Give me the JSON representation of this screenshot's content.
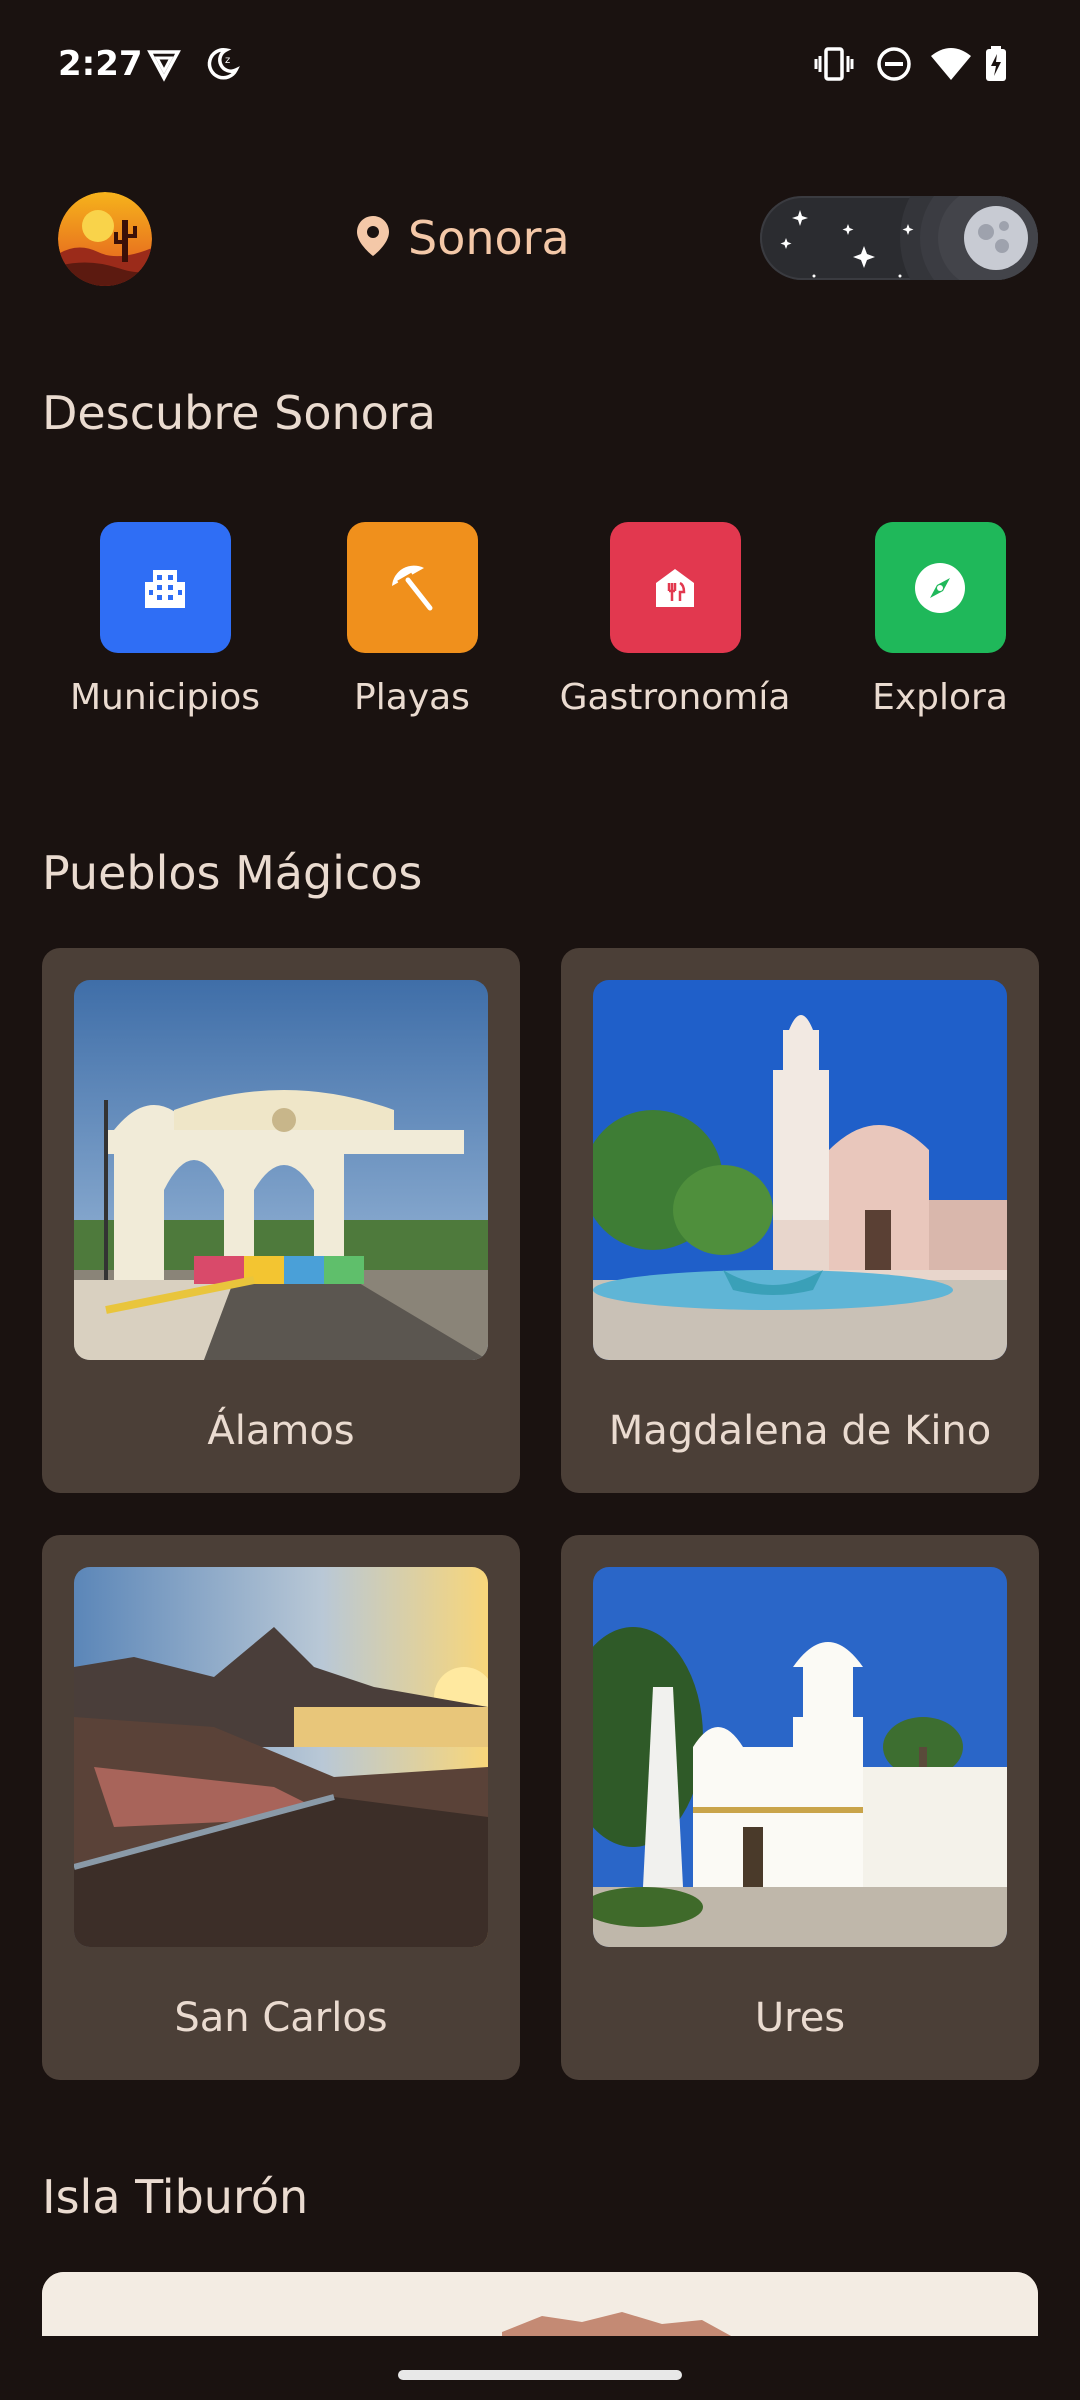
{
  "status_bar": {
    "time": "2:27",
    "left_icons": [
      "vpn-shield-icon",
      "moon-icon"
    ],
    "right_icons": [
      "vibrate-icon",
      "do-not-disturb-icon",
      "wifi-icon",
      "battery-icon"
    ]
  },
  "header": {
    "logo_icon": "desert-cactus-logo",
    "location_icon": "map-pin-icon",
    "location": "Sonora",
    "theme_toggle": "night-mode-toggle"
  },
  "discover": {
    "title": "Descubre Sonora",
    "categories": [
      {
        "label": "Municipios",
        "icon": "building-icon",
        "color": "#2f6ef5"
      },
      {
        "label": "Playas",
        "icon": "beach-umbrella-icon",
        "color": "#f0901c"
      },
      {
        "label": "Gastronomía",
        "icon": "restaurant-icon",
        "color": "#e2384f"
      },
      {
        "label": "Explora",
        "icon": "compass-icon",
        "color": "#1fb85a"
      }
    ]
  },
  "pueblos": {
    "title": "Pueblos Mágicos",
    "items": [
      {
        "label": "Álamos"
      },
      {
        "label": "Magdalena de Kino"
      },
      {
        "label": "San Carlos"
      },
      {
        "label": "Ures"
      }
    ]
  },
  "isla": {
    "title": "Isla Tiburón"
  },
  "colors": {
    "background": "#1a1210",
    "card": "#4b3f37",
    "accent": "#f4c8a8"
  }
}
